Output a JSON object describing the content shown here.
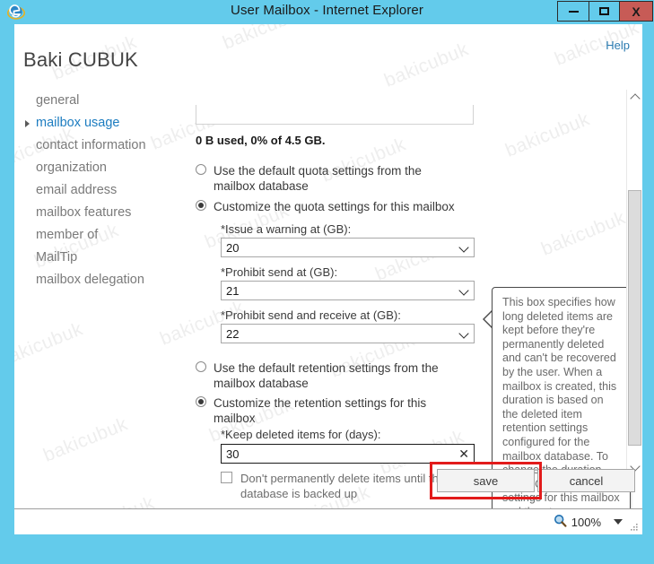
{
  "window": {
    "title": "User Mailbox - Internet Explorer",
    "app_icon": "internet-explorer-icon",
    "controls": {
      "minimize": "minimize-icon",
      "maximize": "maximize-icon",
      "close": "X"
    },
    "accent_color": "#63cbeb",
    "close_color": "#c75b56"
  },
  "watermark": {
    "text": "bakicubuk"
  },
  "header": {
    "help_label": "Help",
    "person_name": "Baki CUBUK"
  },
  "sidebar": {
    "items": [
      {
        "label": "general",
        "active": false
      },
      {
        "label": "mailbox usage",
        "active": true
      },
      {
        "label": "contact information",
        "active": false
      },
      {
        "label": "organization",
        "active": false
      },
      {
        "label": "email address",
        "active": false
      },
      {
        "label": "mailbox features",
        "active": false
      },
      {
        "label": "member of",
        "active": false
      },
      {
        "label": "MailTip",
        "active": false
      },
      {
        "label": "mailbox delegation",
        "active": false
      }
    ],
    "active_color": "#1c7cc0"
  },
  "form": {
    "quota_usage_text": "0 B used, 0% of 4.5 GB.",
    "quota_radio_default": "Use the default quota settings from the mailbox database",
    "quota_radio_custom": "Customize the quota settings for this mailbox",
    "quota_selection": "custom",
    "fields": [
      {
        "label": "*Issue a warning at (GB):",
        "value": "20",
        "type": "combobox"
      },
      {
        "label": "*Prohibit send at (GB):",
        "value": "21",
        "type": "combobox"
      },
      {
        "label": "*Prohibit send and receive at (GB):",
        "value": "22",
        "type": "combobox"
      }
    ],
    "retention_radio_default": "Use the default retention settings from the mailbox database",
    "retention_radio_custom": "Customize the retention settings for this mailbox",
    "retention_selection": "custom",
    "keep_deleted_label": "*Keep deleted items for (days):",
    "keep_deleted_value": "30",
    "keep_deleted_clear_icon": "clear-x-icon",
    "backup_checkbox_label": "Don't permanently delete items until the database is backed up",
    "backup_checkbox_checked": false
  },
  "tooltip": {
    "text": "This box specifies how long deleted items are kept before they're permanently deleted and can't be recovered by the user. When a mailbox is created, this duration is based on the deleted item retention settings configured for the mailbox database. To change the duration, select Customize the settings for this mailbox and then type a new value."
  },
  "scrollbar": {
    "up_icon": "chevron-up-icon",
    "down_icon": "chevron-down-icon"
  },
  "footer": {
    "save_label": "save",
    "cancel_label": "cancel",
    "highlight_color": "#e21b1b"
  },
  "statusbar": {
    "zoom_icon": "magnifier-icon",
    "zoom_level": "100%",
    "zoom_caret_icon": "caret-down-icon",
    "resize_grip_icon": "resize-grip-icon"
  }
}
